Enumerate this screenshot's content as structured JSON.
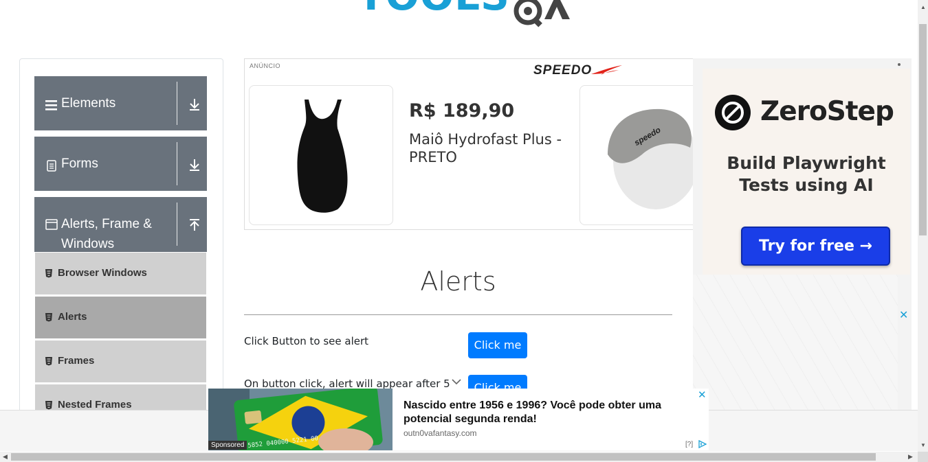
{
  "header": {
    "logo_text": "TOOLSQA"
  },
  "sidebar": {
    "groups": [
      {
        "label": "Elements",
        "icon": "hamburger-icon",
        "expanded": false
      },
      {
        "label": "Forms",
        "icon": "document-icon",
        "expanded": false
      },
      {
        "label": "Alerts, Frame &",
        "label_line2": "Windows",
        "icon": "window-icon",
        "expanded": true
      }
    ],
    "subitems": [
      {
        "label": "Browser Windows",
        "active": false
      },
      {
        "label": "Alerts",
        "active": true
      },
      {
        "label": "Frames",
        "active": false
      },
      {
        "label": "Nested Frames",
        "active": false
      }
    ]
  },
  "ad_banner": {
    "tag": "ANÚNCIO",
    "brand": "SPEEDO",
    "price": "R$ 189,90",
    "product_name": "Maiô Hydrofast Plus - PRETO"
  },
  "right_ad": {
    "brand": "ZeroStep",
    "tagline_line1": "Build Playwright",
    "tagline_line2": "Tests using AI",
    "cta": "Try for free →",
    "close": "✕"
  },
  "main": {
    "title": "Alerts",
    "rows": [
      {
        "label": "Click Button to see alert",
        "button": "Click me"
      },
      {
        "label": "On button click, alert will appear after 5",
        "button": "Click me"
      }
    ]
  },
  "bottom_ad": {
    "sponsored": "Sponsored",
    "headline": "Nascido entre 1956 e 1996? Você pode obter uma potencial segunda renda!",
    "url": "outn0vafantasy.com",
    "help": "[?]",
    "close": "✕"
  },
  "colors": {
    "sidebar_group": "#69727c",
    "subitem": "#d0d0d0",
    "subitem_active": "#a9a9a9",
    "primary_button": "#007bff",
    "logo_blue": "#19a0d6",
    "zerostep_button": "#1a3ee8"
  }
}
